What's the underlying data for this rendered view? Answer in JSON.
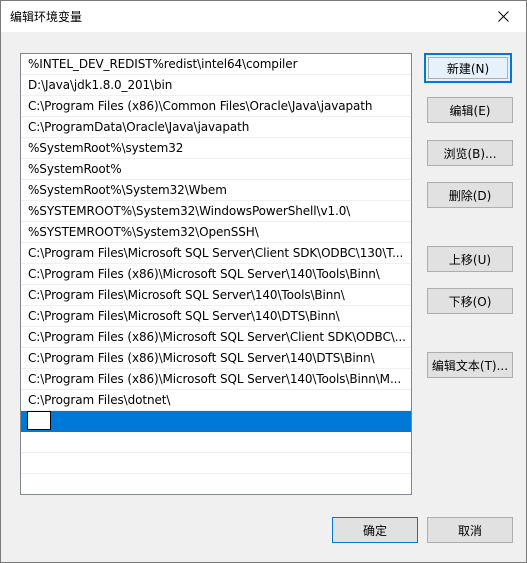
{
  "window": {
    "title": "编辑环境变量"
  },
  "list": {
    "items": [
      "%INTEL_DEV_REDIST%redist\\intel64\\compiler",
      "D:\\Java\\jdk1.8.0_201\\bin",
      "C:\\Program Files (x86)\\Common Files\\Oracle\\Java\\javapath",
      "C:\\ProgramData\\Oracle\\Java\\javapath",
      "%SystemRoot%\\system32",
      "%SystemRoot%",
      "%SystemRoot%\\System32\\Wbem",
      "%SYSTEMROOT%\\System32\\WindowsPowerShell\\v1.0\\",
      "%SYSTEMROOT%\\System32\\OpenSSH\\",
      "C:\\Program Files\\Microsoft SQL Server\\Client SDK\\ODBC\\130\\T...",
      "C:\\Program Files (x86)\\Microsoft SQL Server\\140\\Tools\\Binn\\",
      "C:\\Program Files\\Microsoft SQL Server\\140\\Tools\\Binn\\",
      "C:\\Program Files\\Microsoft SQL Server\\140\\DTS\\Binn\\",
      "C:\\Program Files (x86)\\Microsoft SQL Server\\Client SDK\\ODBC\\...",
      "C:\\Program Files (x86)\\Microsoft SQL Server\\140\\DTS\\Binn\\",
      "C:\\Program Files (x86)\\Microsoft SQL Server\\140\\Tools\\Binn\\M...",
      "C:\\Program Files\\dotnet\\"
    ],
    "editing_value": ""
  },
  "buttons": {
    "new": "新建(N)",
    "edit": "编辑(E)",
    "browse": "浏览(B)...",
    "delete": "删除(D)",
    "move_up": "上移(U)",
    "move_down": "下移(O)",
    "edit_text": "编辑文本(T)...",
    "ok": "确定",
    "cancel": "取消"
  },
  "icons": {
    "close": "close-icon"
  },
  "colors": {
    "selection": "#0078d7",
    "focus_border": "#0078d7"
  }
}
